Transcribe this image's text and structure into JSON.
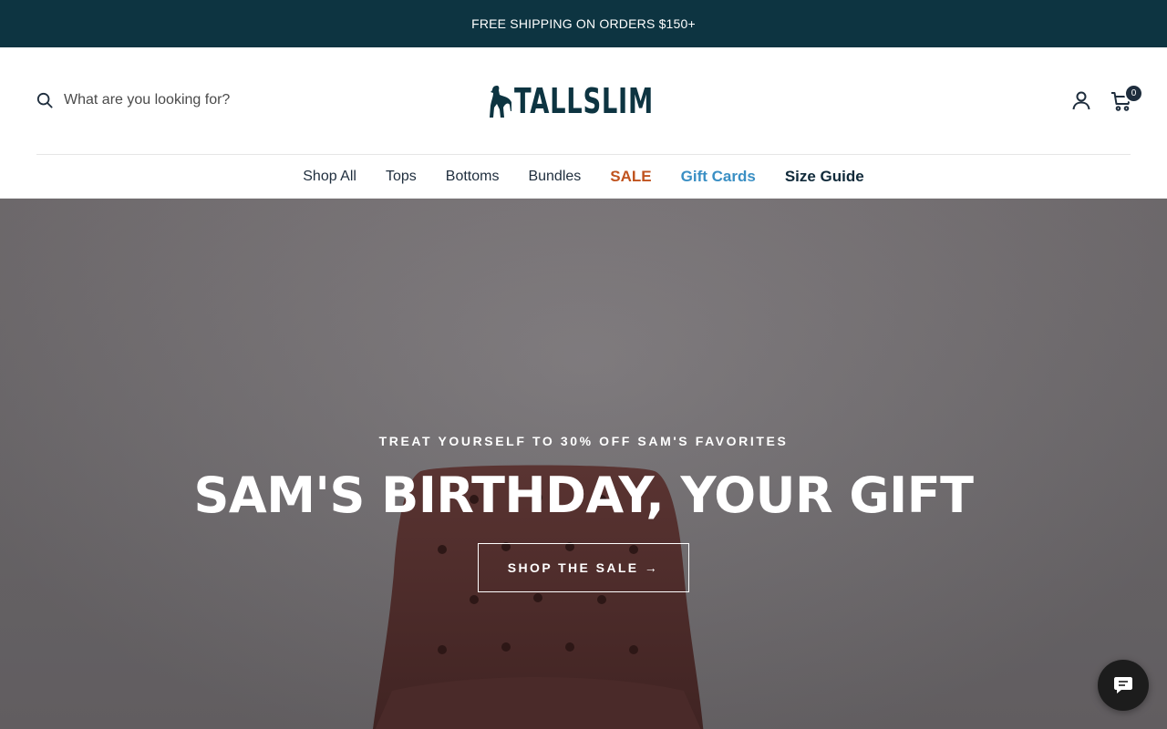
{
  "announcement": {
    "text": "FREE SHIPPING ON ORDERS $150+"
  },
  "header": {
    "search": {
      "placeholder": "What are you looking for?",
      "icon": "search-icon"
    },
    "logo": {
      "text": "TALLSLIM",
      "icon": "greyhound-logo-mark"
    },
    "account": {
      "icon": "user-icon"
    },
    "cart": {
      "icon": "cart-icon",
      "count": "0"
    }
  },
  "nav": {
    "items": [
      {
        "label": "Shop All"
      },
      {
        "label": "Tops"
      },
      {
        "label": "Bottoms"
      },
      {
        "label": "Bundles"
      },
      {
        "label": "SALE",
        "color": "#c0531e"
      },
      {
        "label": "Gift Cards",
        "color": "#3a8fc4"
      },
      {
        "label": "Size Guide",
        "color": "#102a3a"
      }
    ]
  },
  "hero": {
    "kicker": "TREAT YOURSELF TO 30% OFF SAM'S FAVORITES",
    "title": "SAM'S BIRTHDAY, YOUR GIFT",
    "button": "SHOP THE SALE →"
  },
  "chat": {
    "icon": "chat-bubble-icon"
  },
  "colors": {
    "announcement_bg": "#0d3441",
    "brand": "#0d3441",
    "sale": "#c0531e",
    "gift_cards": "#3a8fc4"
  }
}
